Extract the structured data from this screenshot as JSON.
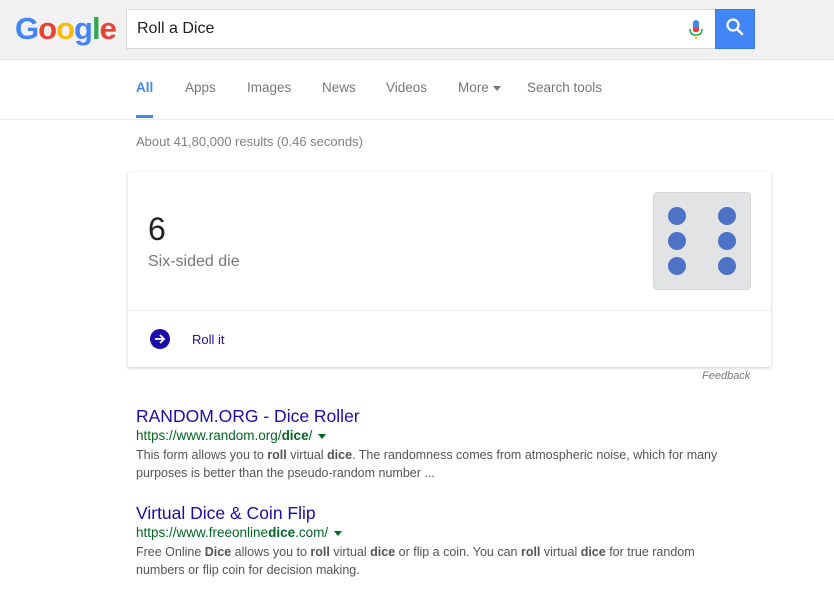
{
  "header": {
    "logo_letters": [
      {
        "char": "G",
        "color": "#4285f4"
      },
      {
        "char": "o",
        "color": "#ea4335"
      },
      {
        "char": "o",
        "color": "#fbbc05"
      },
      {
        "char": "g",
        "color": "#4285f4"
      },
      {
        "char": "l",
        "color": "#34a853"
      },
      {
        "char": "e",
        "color": "#ea4335"
      }
    ],
    "search_query": "Roll a Dice",
    "mic_icon": "microphone-icon",
    "search_icon": "search-icon",
    "accent_color": "#4285f4"
  },
  "tabs": [
    {
      "label": "All",
      "active": true
    },
    {
      "label": "Apps",
      "active": false
    },
    {
      "label": "Images",
      "active": false
    },
    {
      "label": "News",
      "active": false
    },
    {
      "label": "Videos",
      "active": false
    },
    {
      "label": "More",
      "active": false,
      "has_caret": true
    },
    {
      "label": "Search tools",
      "active": false
    }
  ],
  "result_stats": "About 41,80,000 results (0.46 seconds)",
  "dice_card": {
    "value": "6",
    "description": "Six-sided die",
    "pips": 6,
    "pip_color": "#4d72c6",
    "roll_label": "Roll it",
    "roll_icon": "arrow-right-circle-icon"
  },
  "feedback_label": "Feedback",
  "results": [
    {
      "title": "RANDOM.ORG - Dice Roller",
      "url_prefix": "https://www.random.org/",
      "url_bold": "dice",
      "url_suffix": "/",
      "snippet": [
        {
          "text": "This form allows you to ",
          "bold": false
        },
        {
          "text": "roll",
          "bold": true
        },
        {
          "text": " virtual ",
          "bold": false
        },
        {
          "text": "dice",
          "bold": true
        },
        {
          "text": ". The randomness comes from atmospheric noise, which for many purposes is better than the pseudo-random number ...",
          "bold": false
        }
      ]
    },
    {
      "title": "Virtual Dice & Coin Flip",
      "url_prefix": "https://www.freeonline",
      "url_bold": "dice",
      "url_suffix": ".com/",
      "snippet": [
        {
          "text": "Free Online ",
          "bold": false
        },
        {
          "text": "Dice",
          "bold": true
        },
        {
          "text": " allows you to ",
          "bold": false
        },
        {
          "text": "roll",
          "bold": true
        },
        {
          "text": " virtual ",
          "bold": false
        },
        {
          "text": "dice",
          "bold": true
        },
        {
          "text": " or flip a coin. You can ",
          "bold": false
        },
        {
          "text": "roll",
          "bold": true
        },
        {
          "text": " virtual ",
          "bold": false
        },
        {
          "text": "dice",
          "bold": true
        },
        {
          "text": " for true random numbers or flip coin for decision making.",
          "bold": false
        }
      ]
    }
  ]
}
